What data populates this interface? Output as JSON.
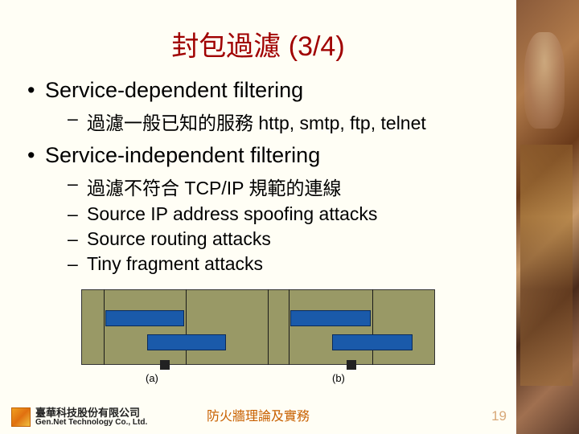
{
  "title": {
    "zh": "封包過濾",
    "suffix": " (3/4)"
  },
  "bullets": {
    "l1a": "Service-dependent filtering",
    "l1a_sub1": "過濾一般已知的服務 http, smtp, ftp, telnet",
    "l1b": "Service-independent filtering",
    "l1b_sub1": "過濾不符合 TCP/IP 規範的連線",
    "l1b_sub2": "Source IP address spoofing attacks",
    "l1b_sub3": "Source routing attacks",
    "l1b_sub4": "Tiny fragment attacks"
  },
  "diagram": {
    "label_a": "(a)",
    "label_b": "(b)"
  },
  "footer": {
    "company_zh": "臺華科技股份有限公司",
    "company_en": "Gen.Net Technology Co., Ltd.",
    "center": "防火牆理論及實務",
    "page": "19"
  }
}
